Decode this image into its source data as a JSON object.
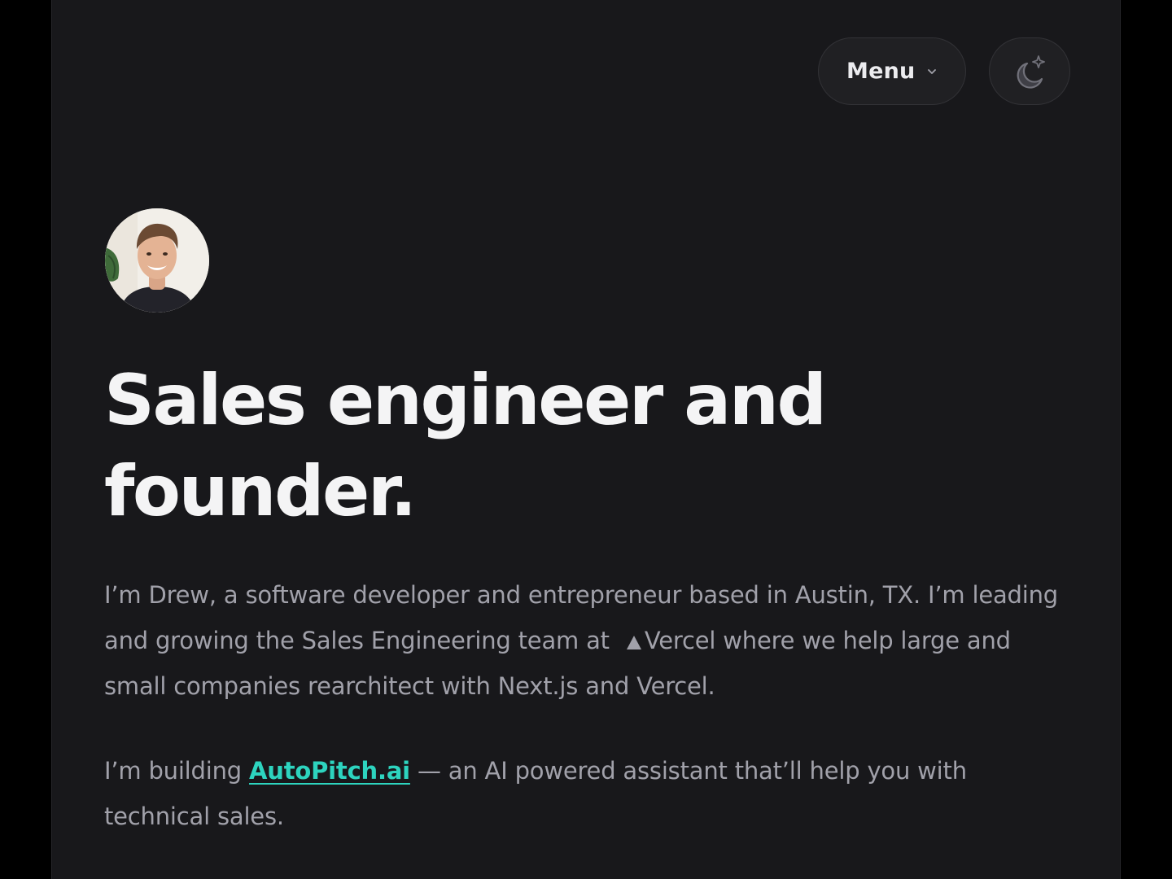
{
  "nav": {
    "menu_label": "Menu",
    "menu_icon": "chevron-down-icon",
    "theme_icon": "moon-sparkle-icon"
  },
  "profile": {
    "avatar_icon": "profile-photo"
  },
  "hero": {
    "headline_line1": "Sales engineer and",
    "headline_line2": "founder."
  },
  "bio": {
    "p1_before": "I’m Drew, a software developer and entrepreneur based in Austin, TX. I’m leading and growing the Sales Engineering team at",
    "p1_link": "Vercel",
    "p1_after": "where we help large and small companies rearchitect with Next.js and Vercel.",
    "p2_before": "I’m building",
    "p2_link": "AutoPitch.ai",
    "p2_after": "— an AI powered assistant that’ll help you with technical sales."
  },
  "colors": {
    "background": "#18181b",
    "outer": "#000000",
    "accent": "#2dd4bf",
    "heading": "#f4f4f5",
    "body_text": "#a1a1aa"
  }
}
